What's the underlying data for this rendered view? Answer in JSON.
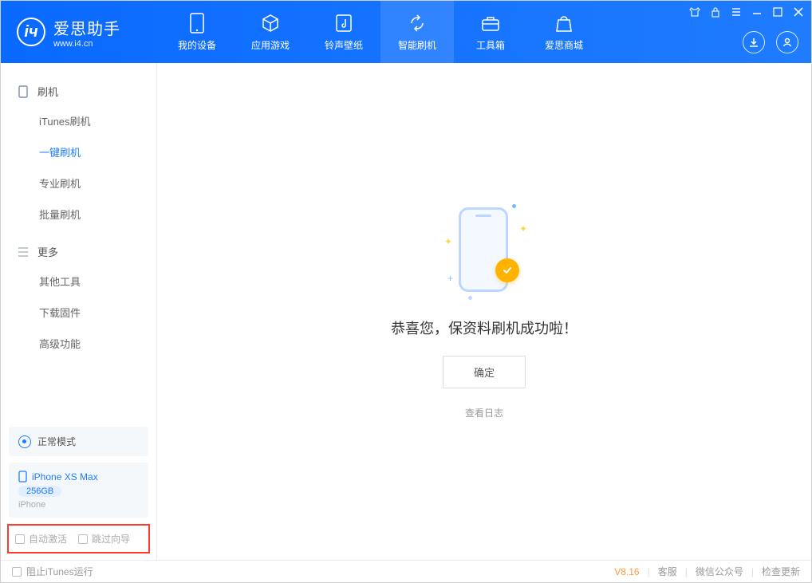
{
  "app": {
    "title": "爱思助手",
    "subtitle": "www.i4.cn"
  },
  "nav": {
    "items": [
      {
        "label": "我的设备",
        "icon": "device"
      },
      {
        "label": "应用游戏",
        "icon": "cube"
      },
      {
        "label": "铃声壁纸",
        "icon": "music"
      },
      {
        "label": "智能刷机",
        "icon": "refresh",
        "active": true
      },
      {
        "label": "工具箱",
        "icon": "toolbox"
      },
      {
        "label": "爱思商城",
        "icon": "bag"
      }
    ]
  },
  "sidebar": {
    "section1_title": "刷机",
    "section1_items": [
      "iTunes刷机",
      "一键刷机",
      "专业刷机",
      "批量刷机"
    ],
    "active_index": 1,
    "section2_title": "更多",
    "section2_items": [
      "其他工具",
      "下载固件",
      "高级功能"
    ],
    "status_label": "正常模式",
    "device": {
      "name": "iPhone XS Max",
      "capacity": "256GB",
      "type": "iPhone"
    },
    "options": {
      "opt1": "自动激活",
      "opt2": "跳过向导"
    }
  },
  "main": {
    "message": "恭喜您，保资料刷机成功啦！",
    "confirm_label": "确定",
    "log_link": "查看日志"
  },
  "footer": {
    "block_itunes": "阻止iTunes运行",
    "version": "V8.16",
    "links": [
      "客服",
      "微信公众号",
      "检查更新"
    ]
  }
}
